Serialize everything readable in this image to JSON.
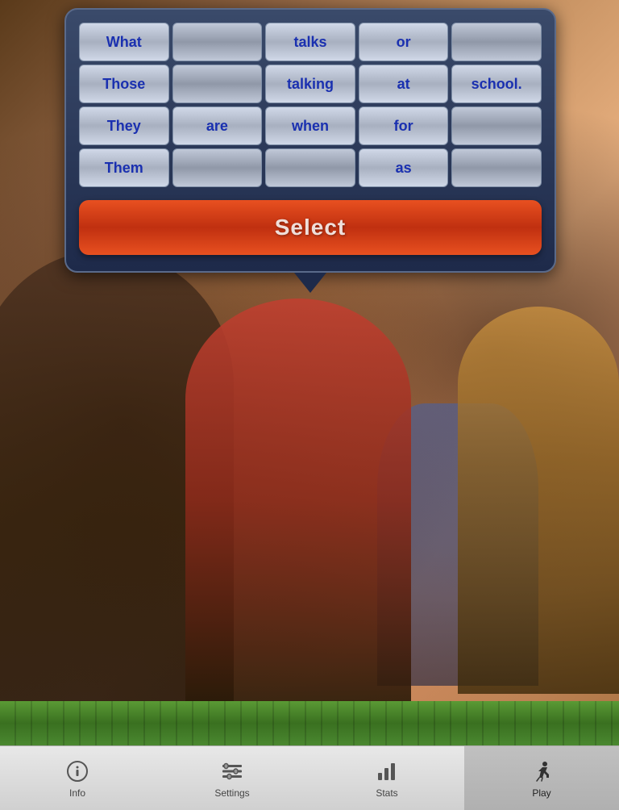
{
  "popup": {
    "grid": {
      "rows": [
        [
          "What",
          "",
          "talks",
          "or",
          ""
        ],
        [
          "Those",
          "",
          "talking",
          "at",
          "school."
        ],
        [
          "They",
          "are",
          "when",
          "for",
          ""
        ],
        [
          "Them",
          "",
          "",
          "as",
          ""
        ]
      ],
      "row1": [
        "What",
        "",
        "talks",
        "or",
        ""
      ],
      "row2": [
        "Those",
        "",
        "talking",
        "at",
        "school."
      ],
      "row3": [
        "They",
        "are",
        "when",
        "for",
        ""
      ],
      "row4": [
        "Them",
        "",
        "",
        "as",
        ""
      ]
    },
    "select_button": "Select"
  },
  "tabs": [
    {
      "id": "info",
      "label": "Info",
      "icon": "info-icon",
      "active": false
    },
    {
      "id": "settings",
      "label": "Settings",
      "icon": "settings-icon",
      "active": false
    },
    {
      "id": "stats",
      "label": "Stats",
      "icon": "stats-icon",
      "active": false
    },
    {
      "id": "play",
      "label": "Play",
      "icon": "play-icon",
      "active": true
    }
  ]
}
